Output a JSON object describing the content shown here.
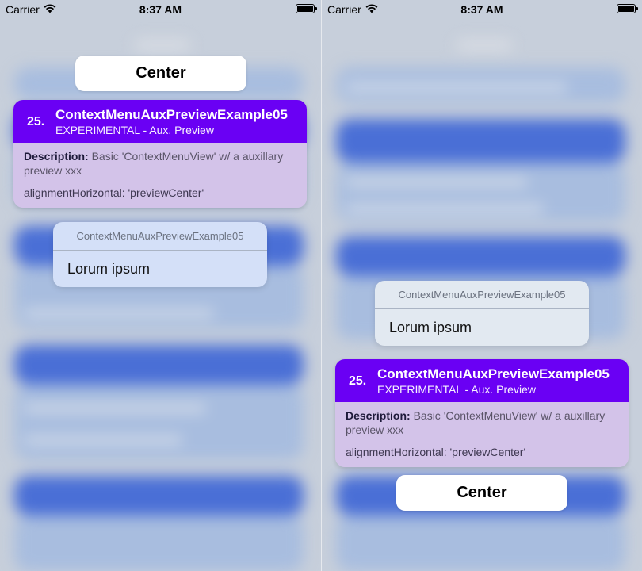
{
  "status_bar": {
    "carrier": "Carrier",
    "time": "8:37 AM"
  },
  "center_button": {
    "label": "Center"
  },
  "card": {
    "number": "25.",
    "title": "ContextMenuAuxPreviewExample05",
    "subtitle": "EXPERIMENTAL - Aux. Preview",
    "description_label": "Description:",
    "description_text": " Basic 'ContextMenuView' w/ a auxillary preview xxx",
    "alignment_text": "alignmentHorizontal: 'previewCenter'"
  },
  "menu": {
    "title": "ContextMenuAuxPreviewExample05",
    "item_label": "Lorum ipsum"
  },
  "colors": {
    "card_header": "#6a00f4",
    "card_body": "#d3c3e9",
    "menu_left_bg": "#d4e0f8",
    "menu_right_bg": "#e2e9f1"
  },
  "icons": {
    "wifi": "wifi-icon",
    "battery": "battery-icon"
  }
}
